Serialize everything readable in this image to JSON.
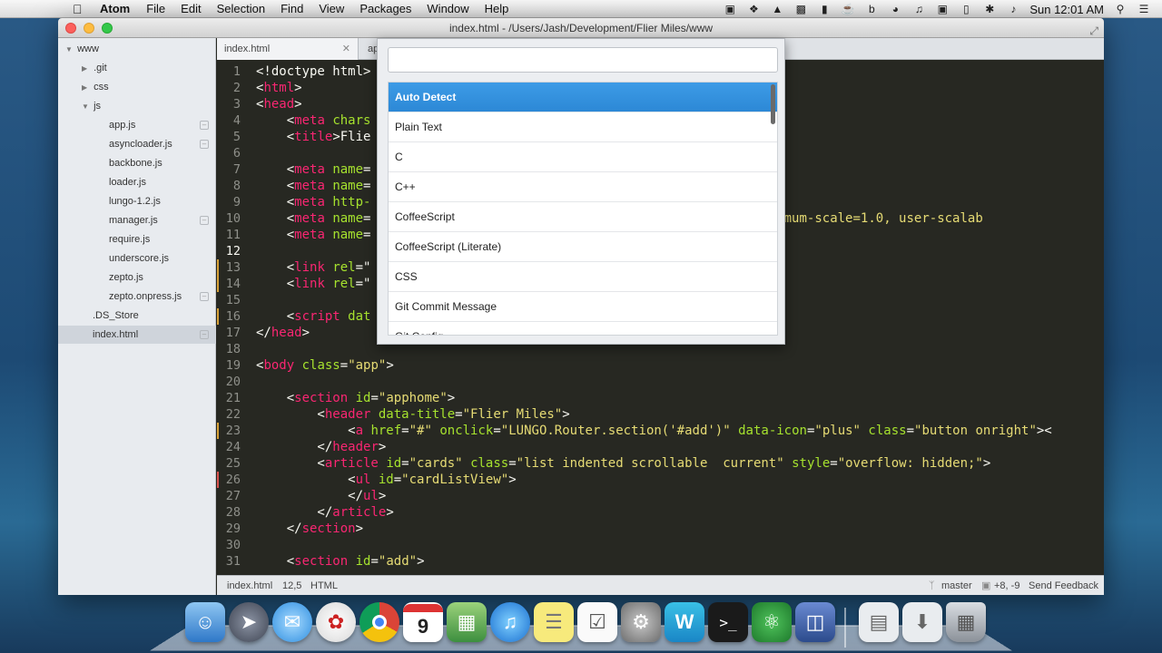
{
  "menubar": {
    "app_name": "Atom",
    "items": [
      "File",
      "Edit",
      "Selection",
      "Find",
      "View",
      "Packages",
      "Window",
      "Help"
    ],
    "clock": "Sun 12:01 AM"
  },
  "window": {
    "title": "index.html - /Users/Jash/Development/Flier Miles/www"
  },
  "sidebar": {
    "items": [
      {
        "label": "www",
        "type": "folder-open"
      },
      {
        "label": ".git",
        "type": "folder"
      },
      {
        "label": "css",
        "type": "folder"
      },
      {
        "label": "js",
        "type": "folder-open"
      },
      {
        "label": "app.js",
        "type": "file"
      },
      {
        "label": "asyncloader.js",
        "type": "file"
      },
      {
        "label": "backbone.js",
        "type": "file"
      },
      {
        "label": "loader.js",
        "type": "file"
      },
      {
        "label": "lungo-1.2.js",
        "type": "file"
      },
      {
        "label": "manager.js",
        "type": "file"
      },
      {
        "label": "require.js",
        "type": "file"
      },
      {
        "label": "underscore.js",
        "type": "file"
      },
      {
        "label": "zepto.js",
        "type": "file"
      },
      {
        "label": "zepto.onpress.js",
        "type": "file"
      },
      {
        "label": ".DS_Store",
        "type": "file"
      },
      {
        "label": "index.html",
        "type": "file",
        "selected": true
      }
    ]
  },
  "tabs": [
    {
      "label": "index.html",
      "active": true
    },
    {
      "label": "ap",
      "active": false
    }
  ],
  "editor": {
    "line_numbers": [
      "1",
      "2",
      "3",
      "4",
      "5",
      "6",
      "7",
      "8",
      "9",
      "10",
      "11",
      "12",
      "13",
      "14",
      "15",
      "16",
      "17",
      "18",
      "19",
      "20",
      "21",
      "22",
      "23",
      "24",
      "25",
      "26",
      "27",
      "28",
      "29",
      "30",
      "31"
    ],
    "current_line": "12"
  },
  "grammar_selector": {
    "input_value": "",
    "items": [
      "Auto Detect",
      "Plain Text",
      "C",
      "C++",
      "CoffeeScript",
      "CoffeeScript (Literate)",
      "CSS",
      "Git Commit Message",
      "Git Config"
    ],
    "selected": "Auto Detect"
  },
  "statusbar": {
    "file": "index.html",
    "cursor": "12,5",
    "grammar": "HTML",
    "branch": "master",
    "diff": "+8, -9",
    "feedback": "Send Feedback"
  },
  "dock": {
    "calendar_day": "9",
    "apps": [
      "finder",
      "launchpad",
      "messages",
      "mail",
      "chrome",
      "calendar",
      "preview",
      "itunes",
      "stickies",
      "reminders",
      "system-preferences",
      "webstorm",
      "terminal",
      "atom",
      "photo-booth",
      "documents",
      "downloads",
      "trash"
    ]
  },
  "colors": {
    "editor_bg": "#272822",
    "tag": "#f92672",
    "attr": "#a6e22e",
    "string": "#e6db74",
    "selection": "#2c88d6"
  }
}
